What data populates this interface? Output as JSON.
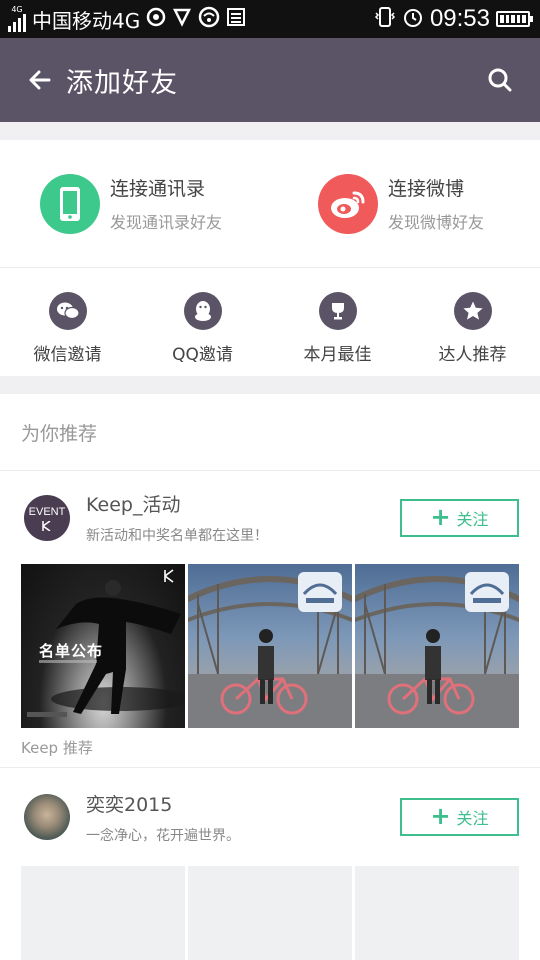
{
  "status_bar": {
    "network_badge": "4G",
    "carrier": "中国移动4G",
    "time": "09:53",
    "icons": [
      "signal-icon",
      "carrier-circle-icon",
      "shield-icon",
      "wifi-icon",
      "sim-icon",
      "vibrate-icon",
      "alarm-icon",
      "battery-icon"
    ]
  },
  "header": {
    "title": "添加好友",
    "back_icon": "arrow-left-icon",
    "search_icon": "search-icon",
    "color": "#5b5366"
  },
  "connect": [
    {
      "title": "连接通讯录",
      "subtitle": "发现通讯录好友",
      "icon": "phone-icon",
      "color": "#3dc98b"
    },
    {
      "title": "连接微博",
      "subtitle": "发现微博好友",
      "icon": "weibo-icon",
      "color": "#f05a5a"
    }
  ],
  "quick_actions": [
    {
      "label": "微信邀请",
      "icon": "wechat-icon"
    },
    {
      "label": "QQ邀请",
      "icon": "qq-penguin-icon"
    },
    {
      "label": "本月最佳",
      "icon": "trophy-icon"
    },
    {
      "label": "达人推荐",
      "icon": "star-icon"
    }
  ],
  "recommend": {
    "section_title": "为你推荐",
    "users": [
      {
        "name": "Keep_活动",
        "description": "新活动和中奖名单都在这里！",
        "follow_label": "关注",
        "avatar_text": "EVENT",
        "photo_1_caption": "名单公布",
        "caption": "Keep 推荐"
      },
      {
        "name": "奕奕2015",
        "description": "一念净心，花开遍世界。",
        "follow_label": "关注"
      }
    ]
  },
  "accent_color": "#3dbe8c"
}
